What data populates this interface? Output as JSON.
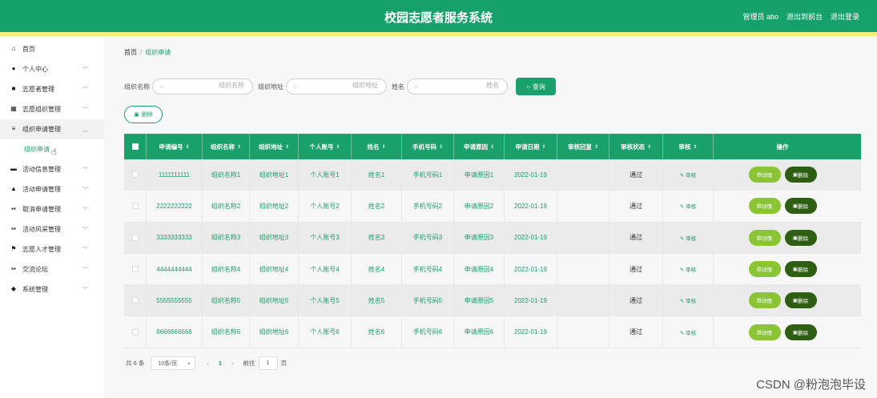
{
  "header": {
    "title": "校园志愿者服务系统",
    "user_label": "管理员 abo",
    "back_front": "退出到前台",
    "logout": "退出登录"
  },
  "sidebar": {
    "items": [
      {
        "label": "首页",
        "icon": "home-icon"
      },
      {
        "label": "个人中心",
        "icon": "person-icon"
      },
      {
        "label": "志愿者管理",
        "icon": "clipboard-icon"
      },
      {
        "label": "志愿组织管理",
        "icon": "grid-icon"
      },
      {
        "label": "组织申请管理",
        "icon": "list-icon"
      },
      {
        "label": "活动信息管理",
        "icon": "ticket-icon"
      },
      {
        "label": "活动申请管理",
        "icon": "thumbs-up-icon"
      },
      {
        "label": "取消申请管理",
        "icon": "apps-icon"
      },
      {
        "label": "活动风采管理",
        "icon": "apps-icon"
      },
      {
        "label": "志愿人才管理",
        "icon": "flag-icon"
      },
      {
        "label": "交流论坛",
        "icon": "apps-icon"
      },
      {
        "label": "系统管理",
        "icon": "location-icon"
      }
    ],
    "submenu_active": "组织申请"
  },
  "breadcrumb": {
    "home": "首页",
    "sep": "/",
    "current": "组织申请"
  },
  "search": {
    "org_name_label": "组织名称",
    "org_name_placeholder": "组织名称",
    "org_addr_label": "组织地址",
    "org_addr_placeholder": "组织地址",
    "name_label": "姓名",
    "name_placeholder": "姓名",
    "button": "查询"
  },
  "delete_button": "删除",
  "table": {
    "headers": [
      "申请编号",
      "组织名称",
      "组织地址",
      "个人账号",
      "姓名",
      "手机号码",
      "申请原因",
      "申请日期",
      "审核回复",
      "审核状态",
      "审核",
      "操作"
    ],
    "rows": [
      [
        "1111111111",
        "组织名称1",
        "组织地址1",
        "个人账号1",
        "姓名1",
        "手机号码1",
        "申请原因1",
        "2022-01-19",
        "",
        "通过"
      ],
      [
        "2222222222",
        "组织名称2",
        "组织地址2",
        "个人账号2",
        "姓名2",
        "手机号码2",
        "申请原因2",
        "2022-01-19",
        "",
        "通过"
      ],
      [
        "3333333333",
        "组织名称3",
        "组织地址3",
        "个人账号3",
        "姓名3",
        "手机号码3",
        "申请原因3",
        "2022-01-19",
        "",
        "通过"
      ],
      [
        "4444444444",
        "组织名称4",
        "组织地址4",
        "个人账号4",
        "姓名4",
        "手机号码4",
        "申请原因4",
        "2022-01-19",
        "",
        "通过"
      ],
      [
        "5555555555",
        "组织名称5",
        "组织地址5",
        "个人账号5",
        "姓名5",
        "手机号码5",
        "申请原因5",
        "2022-01-19",
        "",
        "通过"
      ],
      [
        "6666666666",
        "组织名称6",
        "组织地址6",
        "个人账号6",
        "姓名6",
        "手机号码6",
        "申请原因6",
        "2022-01-19",
        "",
        "通过"
      ]
    ],
    "audit_label": "审核",
    "detail_label": "详情",
    "delete_label": "删除"
  },
  "pagination": {
    "total": "共 6 条",
    "page_size": "10条/页",
    "prev": "‹",
    "current_page": "1",
    "next": "›",
    "goto_label": "前往",
    "goto_value": "1",
    "page_unit": "页"
  },
  "watermark": "CSDN @粉泡泡毕设",
  "colors": {
    "primary": "#1aa06a",
    "accent_yellow": "#f4ee78",
    "detail_btn": "#8bc535",
    "delete_btn": "#2e5e12"
  }
}
